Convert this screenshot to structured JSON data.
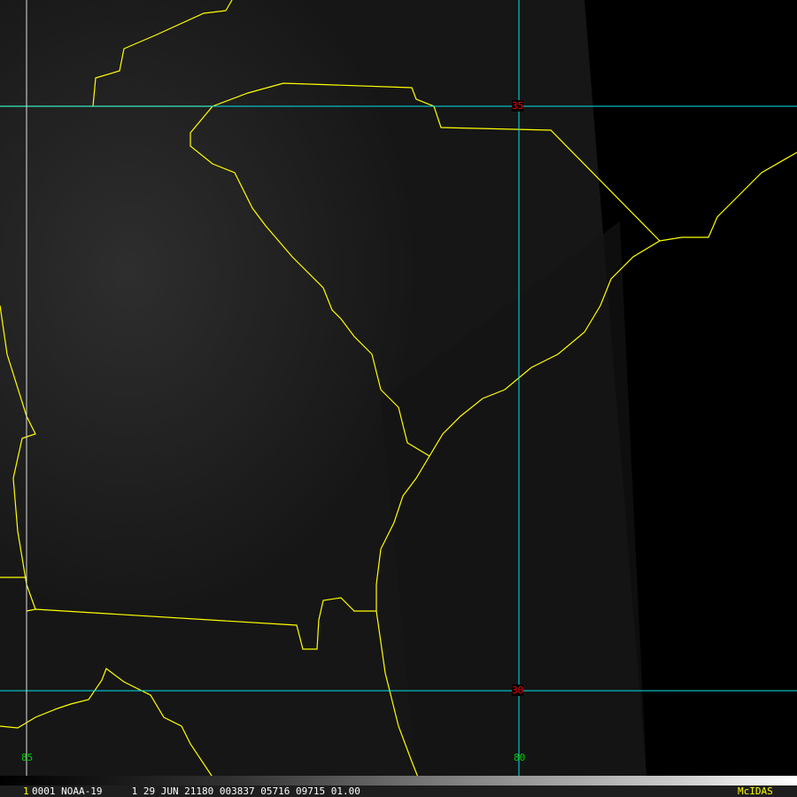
{
  "grid_labels": {
    "lat35": "35",
    "lat30": "30",
    "lon85": "85",
    "lon80": "80"
  },
  "info_bar": {
    "frame": "1",
    "text": "0001 NOAA-19     1 29 JUN 21180 003837 05716 09715 01.00",
    "brand": "McIDAS"
  },
  "colors": {
    "grid": "#00e5ee",
    "borders": "#ffff00",
    "lat_label": "#ff0000",
    "lon_label": "#00cc00",
    "brand": "#ffff00"
  }
}
